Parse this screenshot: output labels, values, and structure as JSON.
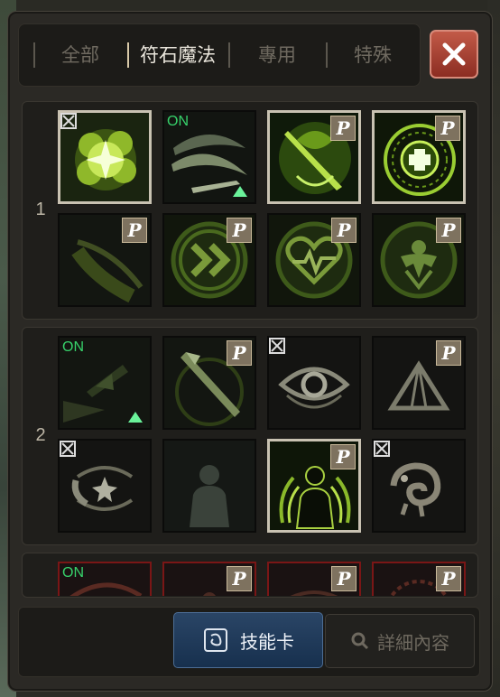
{
  "tabs": [
    {
      "label": "全部",
      "active": false
    },
    {
      "label": "符石魔法",
      "active": true
    },
    {
      "label": "專用",
      "active": false
    },
    {
      "label": "特殊",
      "active": false
    }
  ],
  "close_icon": "close-icon",
  "groups": [
    {
      "number": "1"
    },
    {
      "number": "2"
    }
  ],
  "slots": {
    "g1r1": [
      {
        "icon": "burst-star-icon",
        "badge": "lock-icon",
        "selected": true
      },
      {
        "icon": "sword-slash-icon",
        "status": "ON",
        "upgrade": "up-arrow-icon"
      },
      {
        "icon": "sword-aura-icon",
        "badge": "P"
      },
      {
        "icon": "rune-circle-cross-icon",
        "badge": "P",
        "selected": true
      }
    ],
    "g1r2": [
      {
        "icon": "rune-slash-icon",
        "badge": "P"
      },
      {
        "icon": "double-chevron-icon",
        "badge": "P"
      },
      {
        "icon": "heartbeat-icon",
        "badge": "P"
      },
      {
        "icon": "armor-crest-icon",
        "badge": "P"
      }
    ],
    "g2r1": [
      {
        "icon": "dash-figure-icon",
        "status": "ON",
        "upgrade": "up-arrow-icon"
      },
      {
        "icon": "blade-strike-icon",
        "badge": "P"
      },
      {
        "icon": "eye-icon",
        "badge": "lock-icon"
      },
      {
        "icon": "tent-icon",
        "badge": "P"
      }
    ],
    "g2r2": [
      {
        "icon": "star-swirl-icon",
        "badge": "lock-icon"
      },
      {
        "icon": "shadow-figure-icon"
      },
      {
        "icon": "glowing-figure-icon",
        "badge": "P",
        "selected": true
      },
      {
        "icon": "chameleon-icon",
        "badge": "lock-icon"
      }
    ],
    "g3r1": [
      {
        "icon": "rune-icon",
        "status": "ON"
      },
      {
        "icon": "rune-icon",
        "badge": "P"
      },
      {
        "icon": "rune-icon",
        "badge": "P"
      },
      {
        "icon": "rune-circle-icon",
        "badge": "P"
      }
    ]
  },
  "bottom": {
    "skill_card_label": "技能卡",
    "details_label": "詳細內容"
  },
  "colors": {
    "active_tab": "#eae6dc",
    "inactive_tab": "#6f6a60",
    "on_status": "#37d26b",
    "close_button": "#b44a3a",
    "skill_card_button": "#1f3a5c",
    "rune_green": "#9acd32"
  }
}
